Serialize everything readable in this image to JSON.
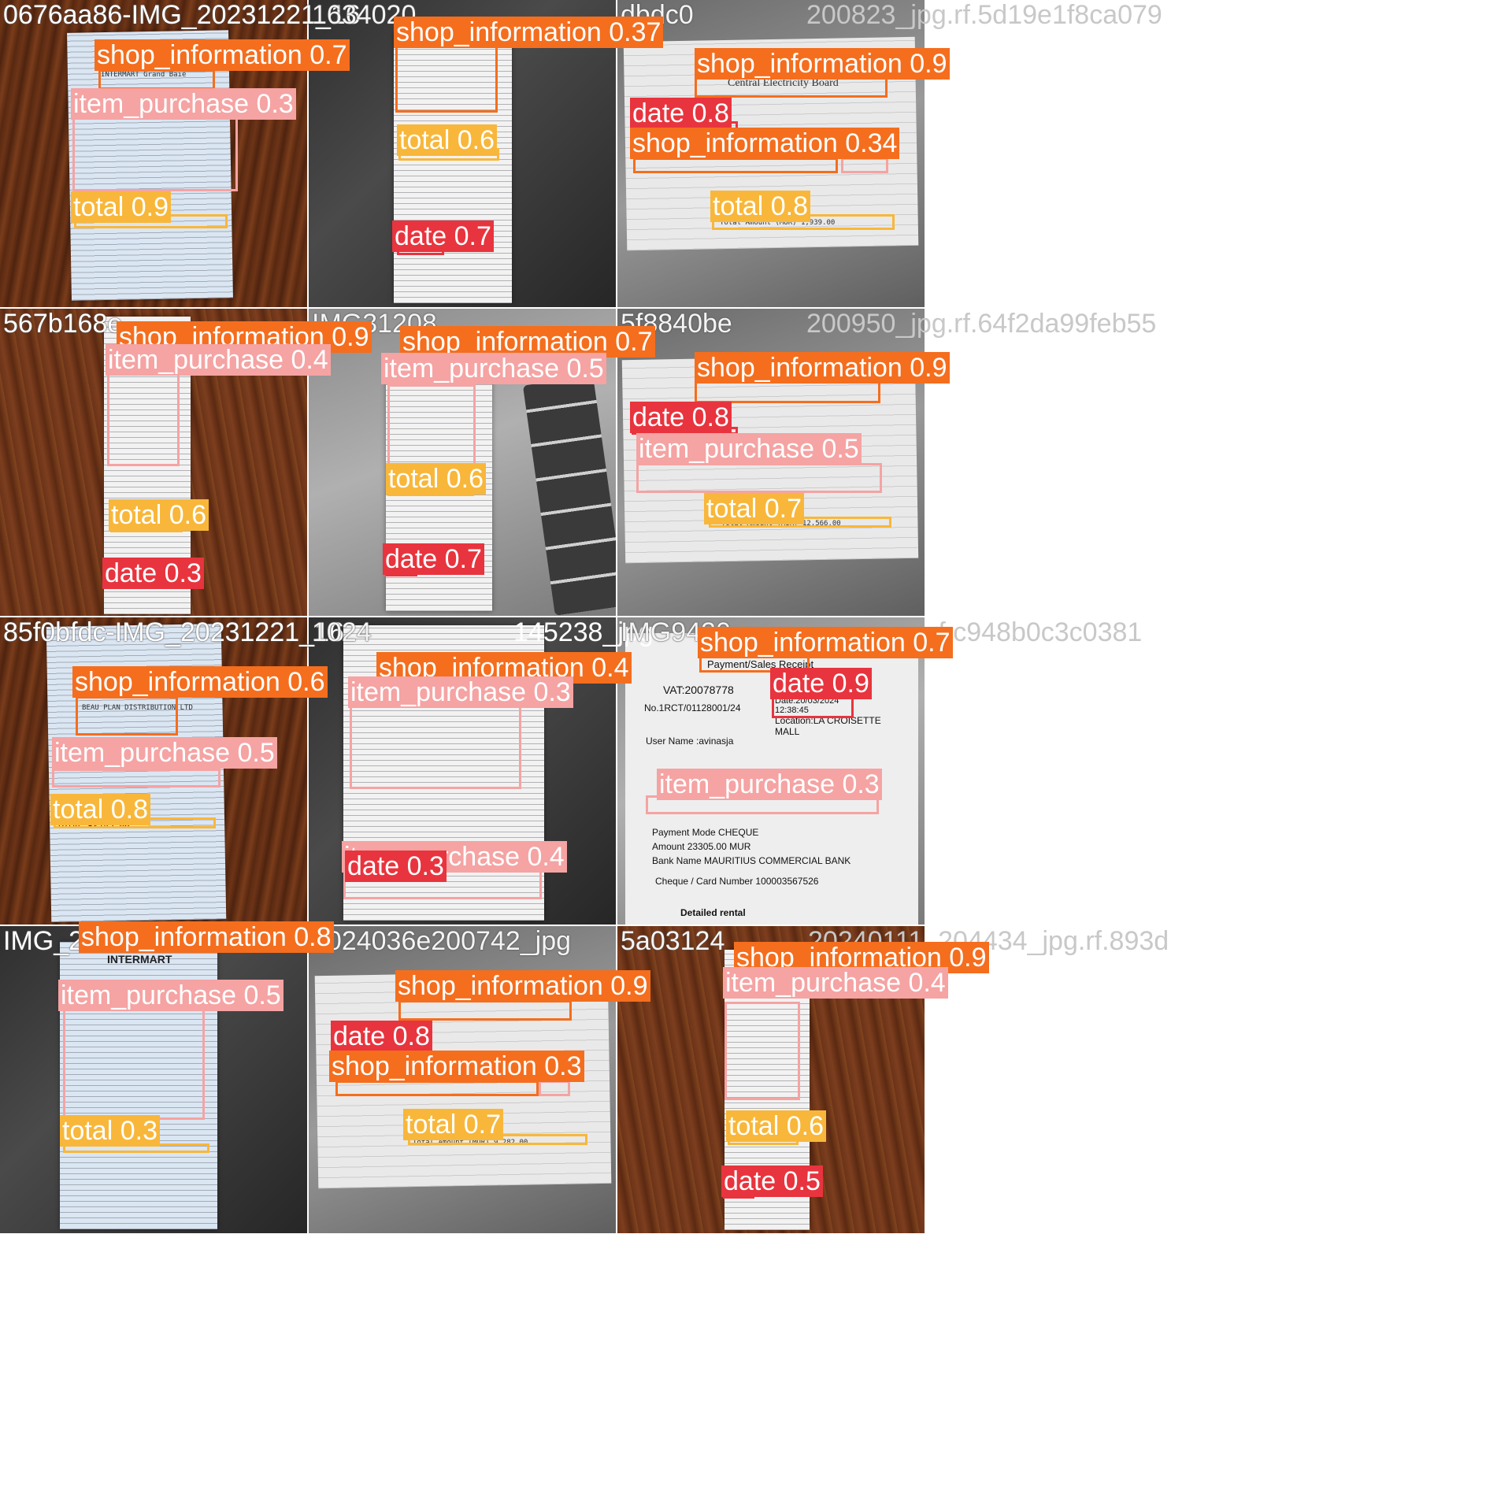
{
  "colors": {
    "shop_information": "#f46e1e",
    "item_purchase": "#f5a3a3",
    "total": "#f8b73a",
    "date": "#e8343e"
  },
  "cells": [
    {
      "title": "0676aa86-IMG_20231221_16",
      "labels": [
        "shop_information 0.7",
        "item_purchase 0.3",
        "total 0.9"
      ]
    },
    {
      "title": "1634020",
      "tail_text": "0",
      "labels": [
        "shop_information 0.37",
        "total 0.6",
        "date 0.7"
      ]
    },
    {
      "title": "dbdc0",
      "tail": "200823_jpg.rf.5d19e1f8ca079",
      "labels": [
        "shop_information 0.9",
        "date 0.8",
        "shop_information 0.34",
        "total 0.8"
      ]
    },
    {
      "title": "567b168e",
      "labels": [
        "shop_information 0.9",
        "item_purchase 0.4",
        "total 0.6",
        "date 0.3"
      ]
    },
    {
      "title": "IMG31208",
      "labels": [
        "shop_information 0.7",
        "item_purchase 0.5",
        "total 0.6",
        "date 0.7"
      ]
    },
    {
      "title": "5f8840be",
      "tail": "200950_jpg.rf.64f2da99feb55",
      "labels": [
        "shop_information 0.9",
        "date 0.8",
        "item_purchase 0.5",
        "total 0.7"
      ]
    },
    {
      "title": "85f0bfdc-IMG_20231221_16",
      "labels": [
        "shop_information 0.6",
        "item_purchase 0.5",
        "total 0.8"
      ]
    },
    {
      "title": "1024",
      "tail_text": "145238_jpg",
      "labels": [
        "shop_information 0.4",
        "item_purchase 0.3",
        "date 0.3",
        "item_purchase 0.4"
      ]
    },
    {
      "title": "IMG9420",
      "tail": "rf.c948b0c3c0381",
      "labels": [
        "shop_information 0.7",
        "date 0.9",
        "item_purchase 0.3"
      ]
    },
    {
      "title": "IMG_2",
      "labels": [
        "shop_information 0.8",
        "item_purchase 0.5",
        "total 0.3"
      ]
    },
    {
      "title": "2024036e200742_jpg",
      "labels": [
        "shop_information 0.9",
        "date 0.8",
        "shop_information 0.3",
        "total 0.7"
      ]
    },
    {
      "title": "5a03124",
      "tail": "20240111_204434_jpg.rf.893d",
      "labels": [
        "shop_information 0.9",
        "item_purchase 0.4",
        "total 0.6",
        "date 0.5"
      ]
    }
  ],
  "receipt_snippets": {
    "c0_header": "INTERMART Grand Baie",
    "c0_total": "TOTAL        Rs990.14",
    "c2_board": "Central Electricity Board",
    "c2_total": "Total Amount (MUR)        1,939.00",
    "c5_total": "Total Amount (MUR)       12,566.00",
    "c6_header": "BEAU PLAN DISTRIBUTION LTD",
    "c6_total": "TOTAL        Rs145.00",
    "c8_receipt": "Payment/Sales Receipt",
    "c8_vat": "VAT:20078778",
    "c8_receipt_no": "No.1RCT/01128001/24",
    "c8_date": "Date:20/03/2024 12:38:45",
    "c8_location": "Location:LA CROISETTE MALL",
    "c8_user": "User Name :avinasja",
    "c8_payment": "Payment Mode       CHEQUE",
    "c8_amount": "Amount     23305.00  MUR",
    "c8_bank": "Bank Name   MAURITIUS COMMERCIAL BANK",
    "c8_cheque": "Cheque / Card Number   100003567526",
    "c8_footer": "Detailed rental",
    "c9_header": "INTERMART",
    "c10_total": "Total Amount (MUR)        9,282.00"
  }
}
